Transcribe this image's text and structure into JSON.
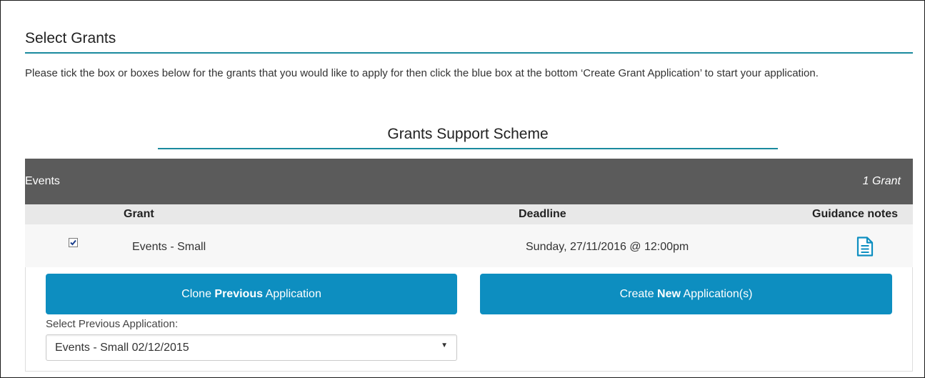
{
  "page": {
    "title": "Select Grants",
    "intro": "Please tick the box or boxes below for the grants that you would like to apply for then click the blue box at the bottom ‘Create Grant Application’ to start your application."
  },
  "scheme": {
    "title": "Grants Support Scheme"
  },
  "category": {
    "name": "Events",
    "count": "1 Grant"
  },
  "table": {
    "headers": {
      "grant": "Grant",
      "deadline": "Deadline",
      "guidance": "Guidance notes"
    },
    "rows": [
      {
        "checked": true,
        "grant": "Events - Small",
        "deadline": "Sunday, 27/11/2016 @ 12:00pm",
        "guidance_icon": "document-icon"
      }
    ]
  },
  "buttons": {
    "clone": {
      "prefix": "Clone ",
      "bold": "Previous",
      "suffix": " Application"
    },
    "create": {
      "prefix": "Create ",
      "bold": "New",
      "suffix": " Application(s)"
    }
  },
  "previous_select": {
    "label": "Select Previous Application:",
    "value": "Events - Small 02/12/2015"
  },
  "colors": {
    "accent_rule": "#1a8a9e",
    "button": "#0d8ec0",
    "header_bar": "#5b5b5b"
  }
}
